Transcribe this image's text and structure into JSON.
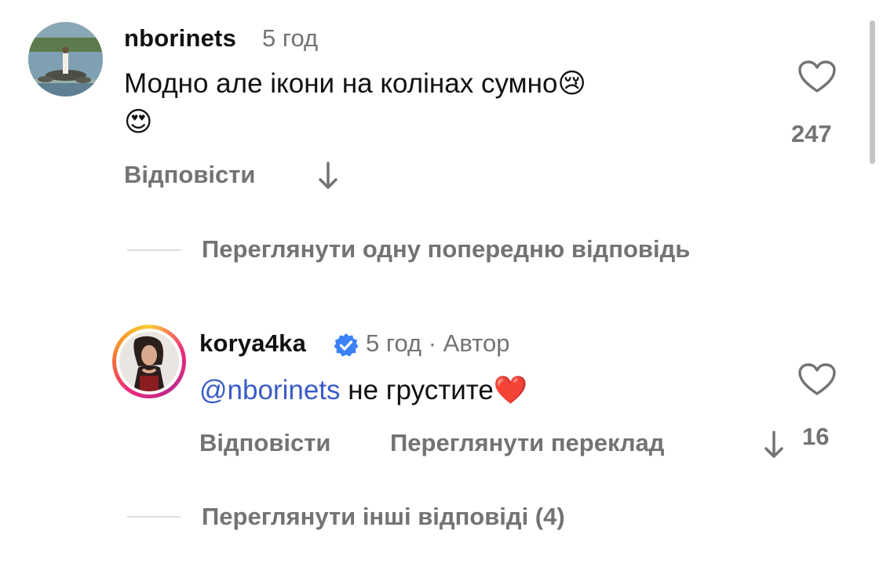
{
  "comments": [
    {
      "username": "nborinets",
      "time": "5 год",
      "text_line1": "Модно але ікони на колінах сумно",
      "emoji1": "😢",
      "emoji2": "😍",
      "reply_label": "Відповісти",
      "likes": "247"
    }
  ],
  "view_previous": "Переглянути одну попередню відповідь",
  "reply": {
    "username": "korya4ka",
    "meta": "5 год · Автор",
    "mention": "@nborinets",
    "text": " не грустите",
    "emoji": "❤️",
    "reply_label": "Відповісти",
    "translate_label": "Переглянути переклад",
    "likes": "16"
  },
  "view_more": "Переглянути інші відповіді (4)",
  "colors": {
    "secondary_text": "#737373",
    "mention": "#3a5bc7",
    "verified": "#3b82f6"
  },
  "icons": [
    "heart-icon",
    "arrow-down-icon",
    "verified-badge-icon"
  ]
}
